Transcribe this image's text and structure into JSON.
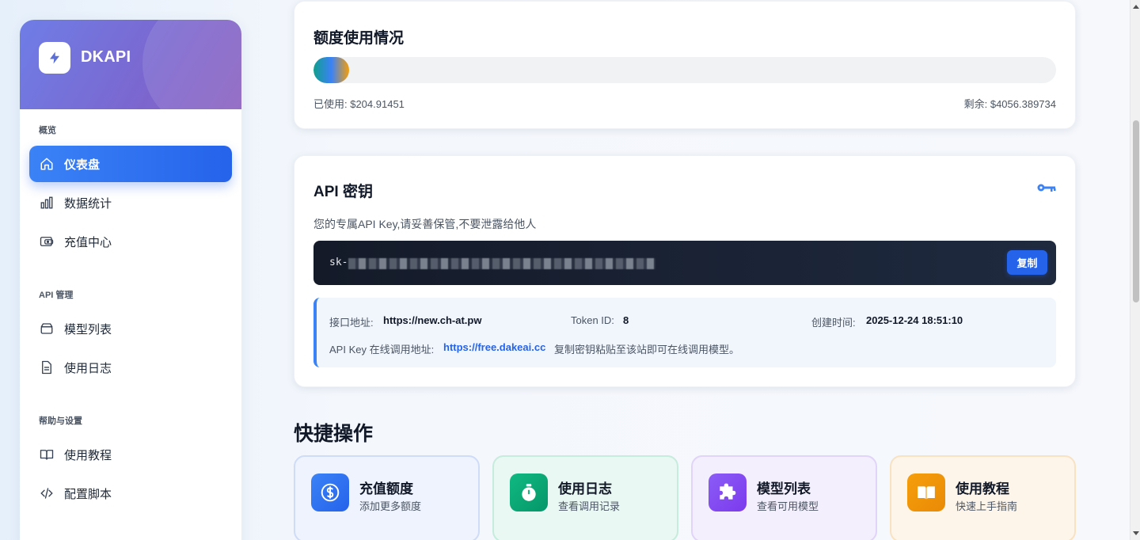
{
  "sidebar": {
    "brand": "DKAPI",
    "sections": {
      "overview": "概览",
      "api": "API 管理",
      "help": "帮助与设置"
    },
    "items": [
      {
        "label": "仪表盘",
        "icon": "home-icon",
        "active": true
      },
      {
        "label": "数据统计",
        "icon": "bar-chart-icon"
      },
      {
        "label": "充值中心",
        "icon": "wallet-icon"
      },
      {
        "label": "模型列表",
        "icon": "layers-icon"
      },
      {
        "label": "使用日志",
        "icon": "document-icon"
      },
      {
        "label": "使用教程",
        "icon": "book-icon"
      },
      {
        "label": "配置脚本",
        "icon": "code-icon"
      }
    ]
  },
  "quota": {
    "title": "额度使用情况",
    "used_label": "已使用: $204.91451",
    "remaining_label": "剩余: $4056.389734",
    "used_fraction": 0.048
  },
  "api_key": {
    "title": "API 密钥",
    "description": "您的专属API Key,请妥善保管,不要泄露给他人",
    "key_prefix": "sk-",
    "copy_label": "复制",
    "endpoint_label": "接口地址:",
    "endpoint_value": "https://new.ch-at.pw",
    "token_id_label": "Token ID:",
    "token_id_value": "8",
    "created_label": "创建时间:",
    "created_value": "2025-12-24 18:51:10",
    "online_label": "API Key 在线调用地址:",
    "online_link": "https://free.dakeai.cc",
    "online_hint": "复制密钥粘贴至该站即可在线调用模型。"
  },
  "quick_actions": {
    "title": "快捷操作",
    "items": [
      {
        "title": "充值额度",
        "subtitle": "添加更多额度",
        "icon": "dollar-icon",
        "color": "#3b82f6"
      },
      {
        "title": "使用日志",
        "subtitle": "查看调用记录",
        "icon": "stopwatch-icon",
        "color": "#10b981"
      },
      {
        "title": "模型列表",
        "subtitle": "查看可用模型",
        "icon": "puzzle-icon",
        "color": "#8b5cf6"
      },
      {
        "title": "使用教程",
        "subtitle": "快速上手指南",
        "icon": "book-open-icon",
        "color": "#f59e0b"
      }
    ]
  }
}
